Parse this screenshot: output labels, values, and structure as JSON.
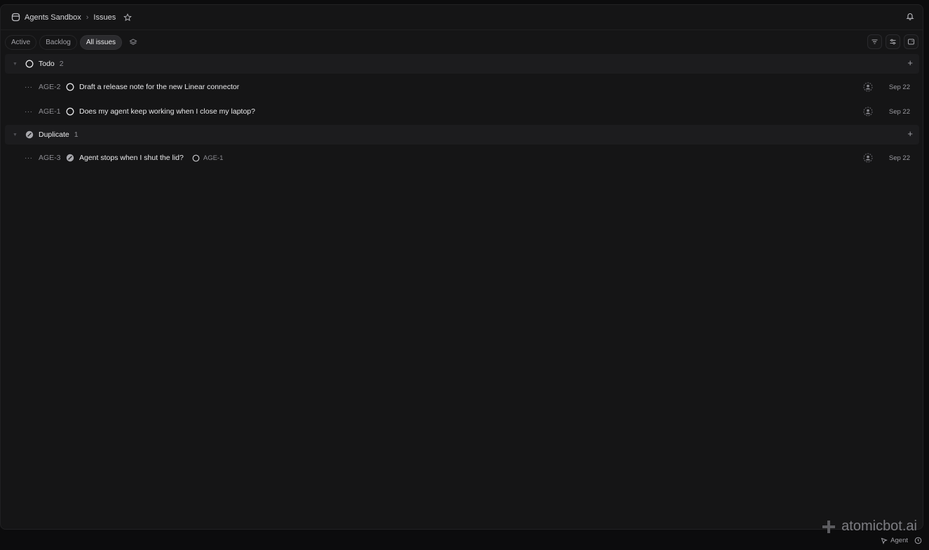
{
  "header": {
    "workspace": "Agents Sandbox",
    "page": "Issues"
  },
  "tabs": [
    {
      "label": "Active",
      "active": false
    },
    {
      "label": "Backlog",
      "active": false
    },
    {
      "label": "All issues",
      "active": true
    }
  ],
  "groups": [
    {
      "label": "Todo",
      "count": "2",
      "status_icon": "todo-circle-icon",
      "issues": [
        {
          "id": "AGE-2",
          "title": "Draft a release note for the new Linear connector",
          "date": "Sep 22"
        },
        {
          "id": "AGE-1",
          "title": "Does my agent keep working when I close my laptop?",
          "date": "Sep 22"
        }
      ]
    },
    {
      "label": "Duplicate",
      "count": "1",
      "status_icon": "duplicate-status-icon",
      "issues": [
        {
          "id": "AGE-3",
          "title": "Agent stops when I shut the lid?",
          "related": "AGE-1",
          "date": "Sep 22"
        }
      ]
    }
  ],
  "footer": {
    "brand": "atomicbot.ai",
    "agent_label": "Agent"
  },
  "colors": {
    "background": "#151516",
    "group_header": "#1c1c1e",
    "text": "#eaeaec",
    "muted": "#8c8c92",
    "active_tab": "#2b2b2e"
  }
}
